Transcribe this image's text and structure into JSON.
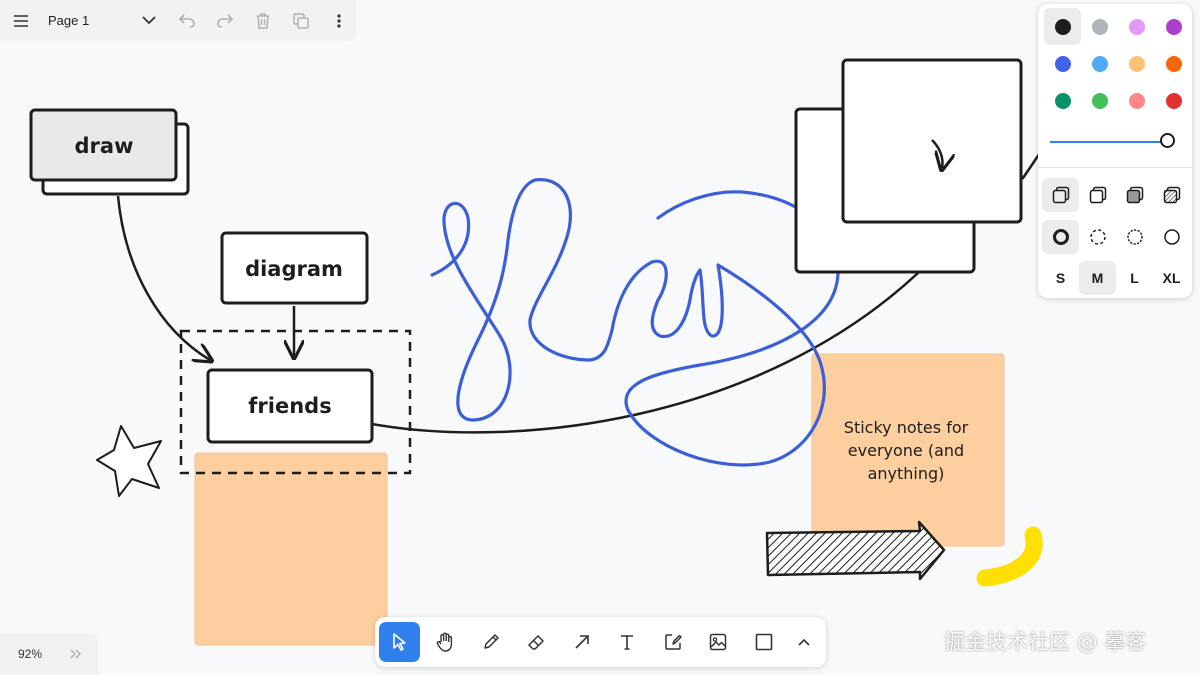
{
  "page_menu": {
    "current_page": "Page 1"
  },
  "shapes": {
    "draw_label": "draw",
    "diagram_label": "diagram",
    "friends_label": "friends",
    "sticky_note_text_lines": [
      "Sticky notes for",
      "everyone (and",
      "anything)"
    ]
  },
  "style_panel": {
    "colors": [
      "#1d1d1d",
      "#adb5bd",
      "#e599f7",
      "#ae3ec9",
      "#4263eb",
      "#4dabf7",
      "#ffc078",
      "#f76707",
      "#099268",
      "#40c057",
      "#ff8787",
      "#e03131"
    ],
    "selected_color": "#1d1d1d",
    "opacity": 1.0,
    "fill_options": [
      "none",
      "semi",
      "solid",
      "pattern"
    ],
    "selected_fill": "none",
    "dash_options": [
      "draw",
      "dashed",
      "dotted",
      "solid"
    ],
    "selected_dash": "draw",
    "sizes": [
      "S",
      "M",
      "L",
      "XL"
    ],
    "selected_size": "M"
  },
  "toolbar": {
    "tools": [
      "select-tool",
      "hand-tool",
      "draw-tool",
      "eraser-tool",
      "arrow-tool",
      "text-tool",
      "note-tool",
      "image-tool",
      "rectangle-tool",
      "more-tools"
    ],
    "active_tool": "select-tool"
  },
  "zoom": {
    "level": "92%"
  },
  "watermark": "掘金技术社区 @ 摹客"
}
